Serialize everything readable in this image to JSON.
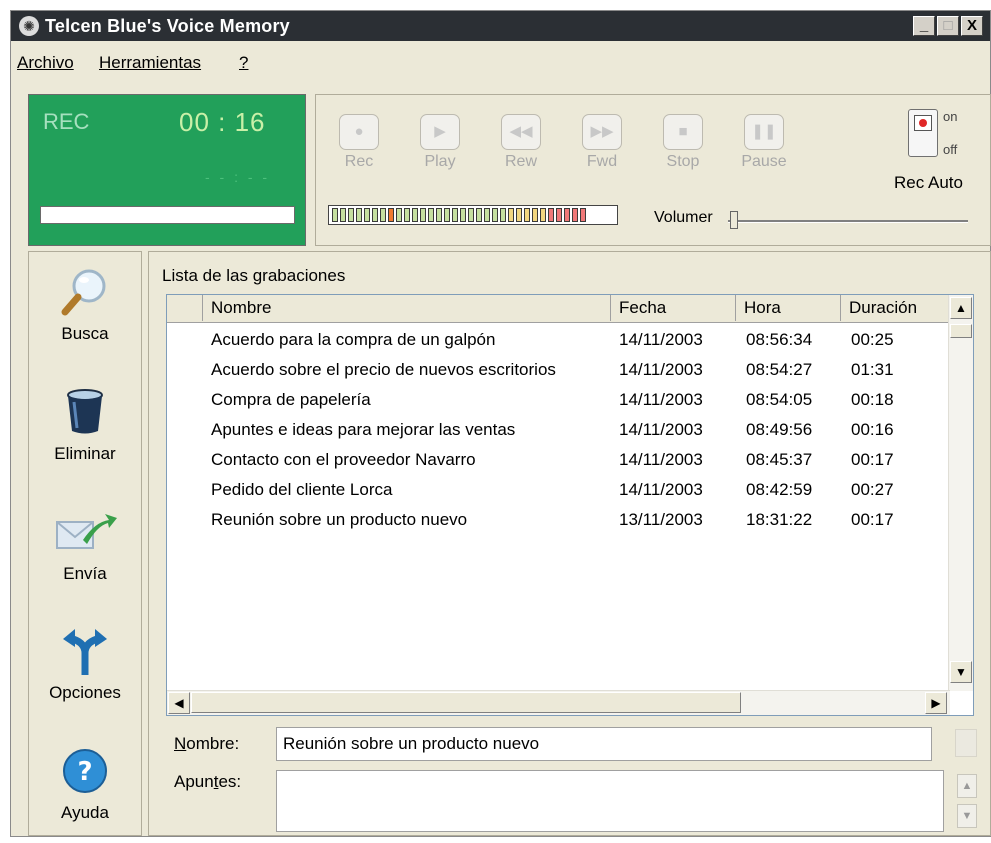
{
  "window": {
    "title": "Telcen Blue's Voice Memory",
    "minimize_glyph": "_",
    "maximize_glyph": "□",
    "close_glyph": "X"
  },
  "menu": [
    {
      "label": "Archivo"
    },
    {
      "label": "Herramientas"
    },
    {
      "label": "?"
    }
  ],
  "lcd": {
    "status": "REC",
    "time": "00 : 16",
    "sub": "- - : - -",
    "progress": 0
  },
  "transport": [
    {
      "label": "Rec",
      "icon": "record-icon"
    },
    {
      "label": "Play",
      "icon": "play-icon"
    },
    {
      "label": "Rew",
      "icon": "rewind-icon"
    },
    {
      "label": "Fwd",
      "icon": "fast-forward-icon"
    },
    {
      "label": "Stop",
      "icon": "stop-icon"
    },
    {
      "label": "Pause",
      "icon": "pause-icon"
    }
  ],
  "rec_auto": {
    "on": "on",
    "off": "off",
    "label": "Rec Auto",
    "state": "on"
  },
  "level_meter": {
    "segments": 32,
    "marker_index": 7
  },
  "volume": {
    "label": "Volumer",
    "level": 0
  },
  "sidebar": [
    {
      "label": "Busca",
      "icon": "magnifier-icon"
    },
    {
      "label": "Eliminar",
      "icon": "trash-bin-icon"
    },
    {
      "label": "Envía",
      "icon": "send-mail-icon"
    },
    {
      "label": "Opciones",
      "icon": "split-arrows-icon"
    },
    {
      "label": "Ayuda",
      "icon": "help-icon"
    }
  ],
  "recordings": {
    "title": "Lista de las grabaciones",
    "columns": [
      "Nombre",
      "Fecha",
      "Hora",
      "Duración"
    ],
    "rows": [
      [
        "Acuerdo para la compra de un galpón",
        "14/11/2003",
        "08:56:34",
        "00:25"
      ],
      [
        "Acuerdo sobre el precio de nuevos escritorios",
        "14/11/2003",
        "08:54:27",
        "01:31"
      ],
      [
        "Compra de papelería",
        "14/11/2003",
        "08:54:05",
        "00:18"
      ],
      [
        "Apuntes e ideas para mejorar las ventas",
        "14/11/2003",
        "08:49:56",
        "00:16"
      ],
      [
        "Contacto con el proveedor Navarro",
        "14/11/2003",
        "08:45:37",
        "00:17"
      ],
      [
        "Pedido del cliente Lorca",
        "14/11/2003",
        "08:42:59",
        "00:27"
      ],
      [
        "Reunión sobre un producto nuevo",
        "13/11/2003",
        "18:31:22",
        "00:17"
      ]
    ]
  },
  "details": {
    "name_label_u": "N",
    "name_label_rest": "ombre:",
    "name_value": "Reunión sobre un producto nuevo",
    "notes_label_pre": "Apun",
    "notes_label_u": "t",
    "notes_label_post": "es:",
    "notes_value": ""
  }
}
